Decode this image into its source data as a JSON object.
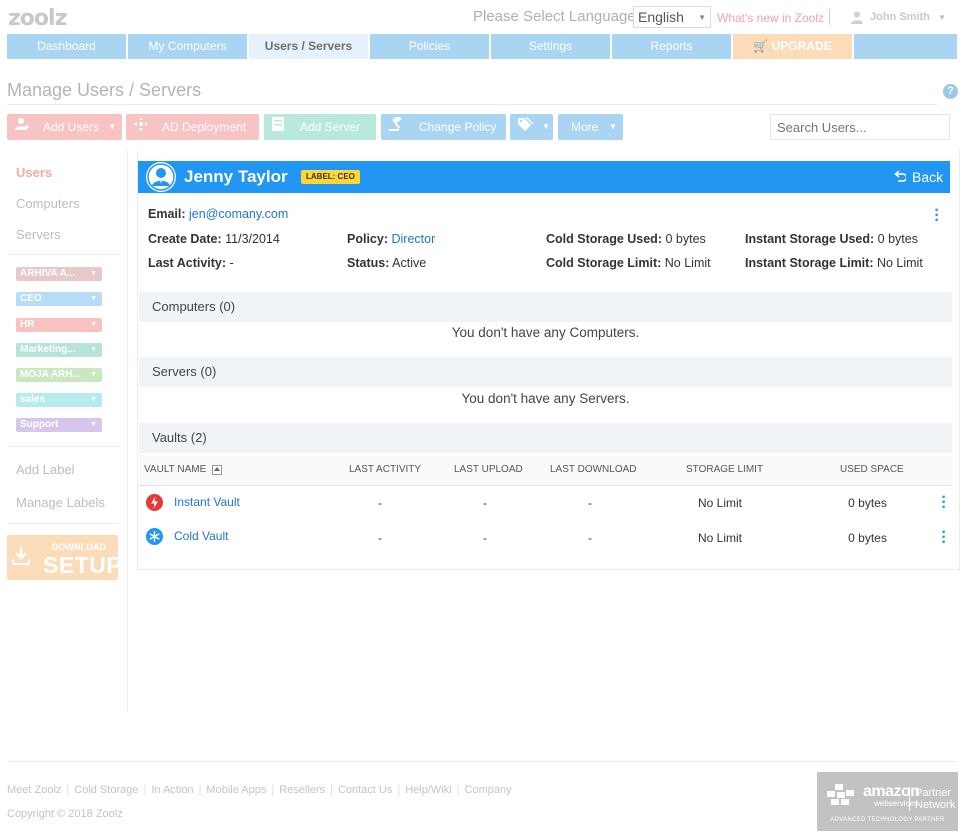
{
  "header": {
    "logo": "zoolz",
    "language_label": "Please Select Language :",
    "language_value": "English",
    "whats_new": "What's new in Zoolz",
    "user_name": "John Smith"
  },
  "nav": {
    "tabs": [
      {
        "label": "Dashboard"
      },
      {
        "label": "My Computers"
      },
      {
        "label": "Users / Servers"
      },
      {
        "label": "Policies"
      },
      {
        "label": "Settings"
      },
      {
        "label": "Reports"
      },
      {
        "label": "UPGRADE"
      },
      {
        "label": ""
      }
    ]
  },
  "page": {
    "title": "Manage Users / Servers",
    "help": "?"
  },
  "toolbar": {
    "add_users": "Add Users",
    "ad_deployment": "AD Deployment",
    "add_server": "Add Server",
    "change_policy": "Change Policy",
    "more": "More",
    "search_placeholder": "Search Users..."
  },
  "sidebar": {
    "links": [
      "Users",
      "Computers",
      "Servers"
    ],
    "labels": [
      {
        "name": "ARHIVA A...",
        "color": "#e6c9c9"
      },
      {
        "name": "CEO",
        "color": "#b7dcf6"
      },
      {
        "name": "HR",
        "color": "#f8c2c2"
      },
      {
        "name": "Marketing...",
        "color": "#b7e4d9"
      },
      {
        "name": "MOJA ARH...",
        "color": "#c9e8c0"
      },
      {
        "name": "sales",
        "color": "#b8ecec"
      },
      {
        "name": "Support",
        "color": "#d6c6ec"
      }
    ],
    "add_label": "Add Label",
    "manage_labels": "Manage Labels",
    "download_top": "DOWNLOAD",
    "download_big": "SETUP"
  },
  "user": {
    "name": "Jenny Taylor",
    "badge": "LABEL: CEO",
    "back": "Back",
    "email_label": "Email:",
    "email": "jen@comany.com",
    "create_date_label": "Create Date:",
    "create_date": "11/3/2014",
    "last_activity_label": "Last Activity:",
    "last_activity": "-",
    "policy_label": "Policy:",
    "policy": "Director",
    "status_label": "Status:",
    "status": "Active",
    "cold_used_label": "Cold Storage Used:",
    "cold_used": "0 bytes",
    "cold_limit_label": "Cold Storage Limit:",
    "cold_limit": "No Limit",
    "instant_used_label": "Instant Storage Used:",
    "instant_used": "0 bytes",
    "instant_limit_label": "Instant Storage Limit:",
    "instant_limit": "No Limit"
  },
  "sections": {
    "computers_title": "Computers (0)",
    "computers_empty": "You don't have any Computers.",
    "servers_title": "Servers (0)",
    "servers_empty": "You don't have any Servers.",
    "vaults_title": "Vaults (2)"
  },
  "vaults_table": {
    "columns": [
      "VAULT NAME",
      "LAST ACTIVITY",
      "LAST UPLOAD",
      "LAST DOWNLOAD",
      "STORAGE LIMIT",
      "USED SPACE"
    ],
    "rows": [
      {
        "name": "Instant Vault",
        "icon": "lightning-icon",
        "color": "#e53935",
        "last_activity": "-",
        "last_upload": "-",
        "last_download": "-",
        "storage_limit": "No Limit",
        "used_space": "0 bytes"
      },
      {
        "name": "Cold Vault",
        "icon": "snowflake-icon",
        "color": "#2196f3",
        "last_activity": "-",
        "last_upload": "-",
        "last_download": "-",
        "storage_limit": "No Limit",
        "used_space": "0 bytes"
      }
    ]
  },
  "footer": {
    "links": [
      "Meet Zoolz",
      "Cold Storage",
      "In Action",
      "Mobile Apps",
      "Resellers",
      "Contact Us",
      "Help/Wiki",
      "Company"
    ],
    "copyright": "Copyright © 2018 Zoolz",
    "aws_main": "amazon",
    "aws_sub": "webservices",
    "aws_partner": "Partner",
    "aws_network": "Network",
    "aws_tag": "ADVANCED TECHNOLOGY PARTNER"
  },
  "colors": {
    "accent": "#2196f3",
    "link": "#1e78c8",
    "badge": "#ffd633"
  }
}
